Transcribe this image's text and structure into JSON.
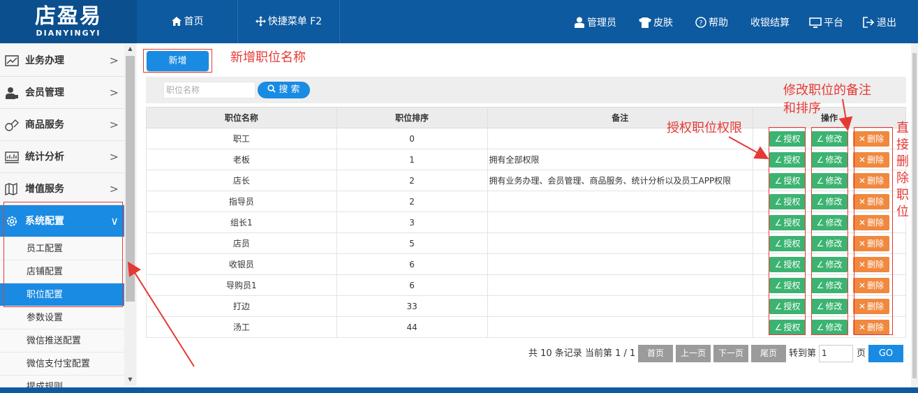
{
  "brand": {
    "name": "店盈易",
    "pinyin": "DIANYINGYI"
  },
  "topnav": {
    "left": [
      {
        "icon": "home-icon",
        "label": "首页"
      },
      {
        "icon": "move-icon",
        "label": "快捷菜单 F2"
      }
    ],
    "right": [
      {
        "icon": "user-icon",
        "label": "管理员"
      },
      {
        "icon": "shirt-icon",
        "label": "皮肤"
      },
      {
        "icon": "help-icon",
        "label": "帮助"
      },
      {
        "icon": "",
        "label": "收银结算"
      },
      {
        "icon": "monitor-icon",
        "label": "平台"
      },
      {
        "icon": "logout-icon",
        "label": "退出"
      }
    ]
  },
  "sidebar": {
    "items": [
      {
        "icon": "chart-icon",
        "label": "业务办理"
      },
      {
        "icon": "member-icon",
        "label": "会员管理"
      },
      {
        "icon": "goods-icon",
        "label": "商品服务"
      },
      {
        "icon": "stats-icon",
        "label": "统计分析"
      },
      {
        "icon": "map-icon",
        "label": "增值服务"
      },
      {
        "icon": "gear-icon",
        "label": "系统配置"
      }
    ],
    "subitems": [
      "员工配置",
      "店铺配置",
      "职位配置",
      "参数设置",
      "微信推送配置",
      "微信支付宝配置",
      "提成规则"
    ]
  },
  "toolbar": {
    "add_label": "新增"
  },
  "search": {
    "placeholder": "职位名称",
    "button_label": "搜 索"
  },
  "table": {
    "headers": [
      "职位名称",
      "职位排序",
      "备注",
      "操作"
    ],
    "rows": [
      {
        "name": "职工",
        "order": "0",
        "note": ""
      },
      {
        "name": "老板",
        "order": "1",
        "note": "拥有全部权限"
      },
      {
        "name": "店长",
        "order": "2",
        "note": "拥有业务办理、会员管理、商品服务、统计分析以及员工APP权限"
      },
      {
        "name": "指导员",
        "order": "2",
        "note": ""
      },
      {
        "name": "组长1",
        "order": "3",
        "note": ""
      },
      {
        "name": "店员",
        "order": "5",
        "note": ""
      },
      {
        "name": "收银员",
        "order": "6",
        "note": ""
      },
      {
        "name": "导购员1",
        "order": "6",
        "note": ""
      },
      {
        "name": "打边",
        "order": "33",
        "note": ""
      },
      {
        "name": "汤工",
        "order": "44",
        "note": ""
      }
    ],
    "actions": {
      "auth": "授权",
      "edit": "修改",
      "delete": "删除"
    }
  },
  "pager": {
    "summary": "共 10 条记录 当前第 1 / 1",
    "first": "首页",
    "prev": "上一页",
    "next": "下一页",
    "last": "尾页",
    "goto_label": "转到第",
    "goto_value": "1",
    "page_suffix": "页",
    "go": "GO"
  },
  "annotations": {
    "add": "新增职位名称",
    "auth": "授权职位权限",
    "edit": "修改职位的备注和排序",
    "delete": "直接删除职位"
  },
  "colors": {
    "header": "#0e5aa0",
    "accent": "#1a8be2",
    "green": "#3cb371",
    "orange": "#f0883e",
    "annotation": "#e53935"
  }
}
